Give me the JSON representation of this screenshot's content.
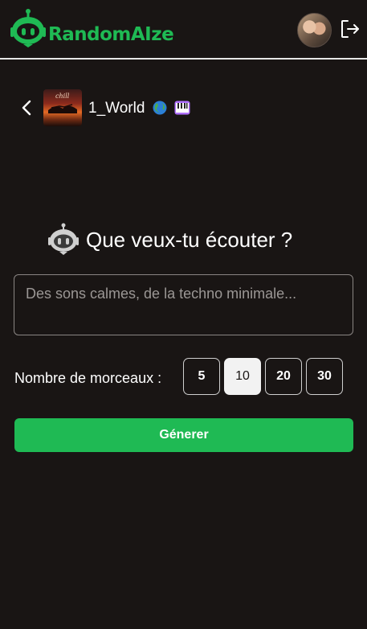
{
  "header": {
    "brand_prefix": "Random",
    "brand_suffix": "AIze",
    "brand_prefix_color": "#1fba54",
    "brand_suffix_color": "#1fba54",
    "logo_icon": "robot-logo-icon",
    "avatar_icon": "user-avatar",
    "logout_icon": "logout-icon"
  },
  "playlist": {
    "name": "1_World",
    "emojis": [
      "globe-icon",
      "piano-icon"
    ],
    "cover_text": "chill"
  },
  "main": {
    "heading": "Que veux-tu écouter ?",
    "prompt_placeholder": "Des sons calmes, de la techno minimale...",
    "prompt_value": "",
    "count_label": "Nombre de morceaux :",
    "count_options": [
      "5",
      "10",
      "20",
      "30"
    ],
    "selected_count": "10",
    "generate_label": "Génerer"
  },
  "colors": {
    "background": "#191514",
    "accent": "#1fba54",
    "text": "#ffffff"
  }
}
